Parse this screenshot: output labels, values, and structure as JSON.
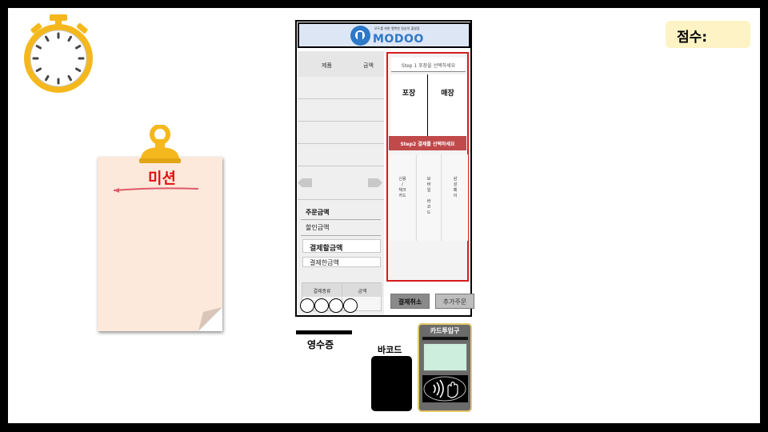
{
  "score": {
    "label": "점수:"
  },
  "mission": {
    "title": "미션"
  },
  "kiosk": {
    "brand": "MODOO",
    "tagline": "모두를 위한 행복한 일상의 출발점",
    "order_list": {
      "col_product": "제품",
      "col_amount": "금액"
    },
    "order_amount_label": "주문금액",
    "discount_amount_label": "할인금액",
    "payable_amount_label": "결제할금액",
    "paid_amount_label": "결제한금액",
    "payment_table": {
      "col_type": "결제종류",
      "col_amount": "금액"
    },
    "step1": {
      "title": "Step 1  포장을 선택하세요",
      "options": [
        "포장",
        "매장"
      ]
    },
    "step2": {
      "title": "Step2  결제를 선택하세요",
      "methods": [
        "신용\n/\n체크\n카드",
        "모\n바\n일\n\n바\n코\n드",
        "삼\n성\n페\n이"
      ]
    },
    "cancel_payment_label": "결제취소",
    "add_order_label": "추가주문"
  },
  "devices": {
    "receipt_label": "영수증",
    "barcode_label": "바코드",
    "card_reader_label": "카드투입구"
  },
  "colors": {
    "accent_red": "#d41c1c",
    "brand_blue": "#2e78c8",
    "score_bg": "#fdf3c4",
    "note_bg": "#fce9db"
  }
}
